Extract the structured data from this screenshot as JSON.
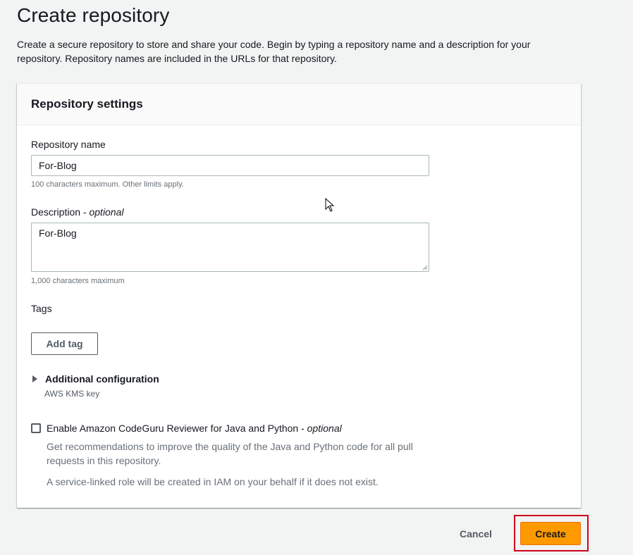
{
  "page": {
    "title": "Create repository",
    "description": "Create a secure repository to store and share your code. Begin by typing a repository name and a description for your repository. Repository names are included in the URLs for that repository."
  },
  "settings": {
    "header": "Repository settings",
    "name_label": "Repository name",
    "name_value": "For-Blog",
    "name_hint": "100 characters maximum. Other limits apply.",
    "description_label": "Description",
    "description_optional": "optional",
    "description_value": "For-Blog",
    "description_hint": "1,000 characters maximum",
    "tags_label": "Tags",
    "add_tag_label": "Add tag",
    "additional_config_label": "Additional configuration",
    "kms_key_label": "AWS KMS key",
    "codeguru_label": "Enable Amazon CodeGuru Reviewer for Java and Python",
    "codeguru_optional": "optional",
    "codeguru_checked": false,
    "codeguru_desc": "Get recommendations to improve the quality of the Java and Python code for all pull requests in this repository.",
    "codeguru_note": "A service-linked role will be created in IAM on your behalf if it does not exist."
  },
  "footer": {
    "cancel_label": "Cancel",
    "create_label": "Create"
  },
  "colors": {
    "primary": "#ff9900",
    "highlight": "#d0021b",
    "background": "#f2f3f3"
  }
}
